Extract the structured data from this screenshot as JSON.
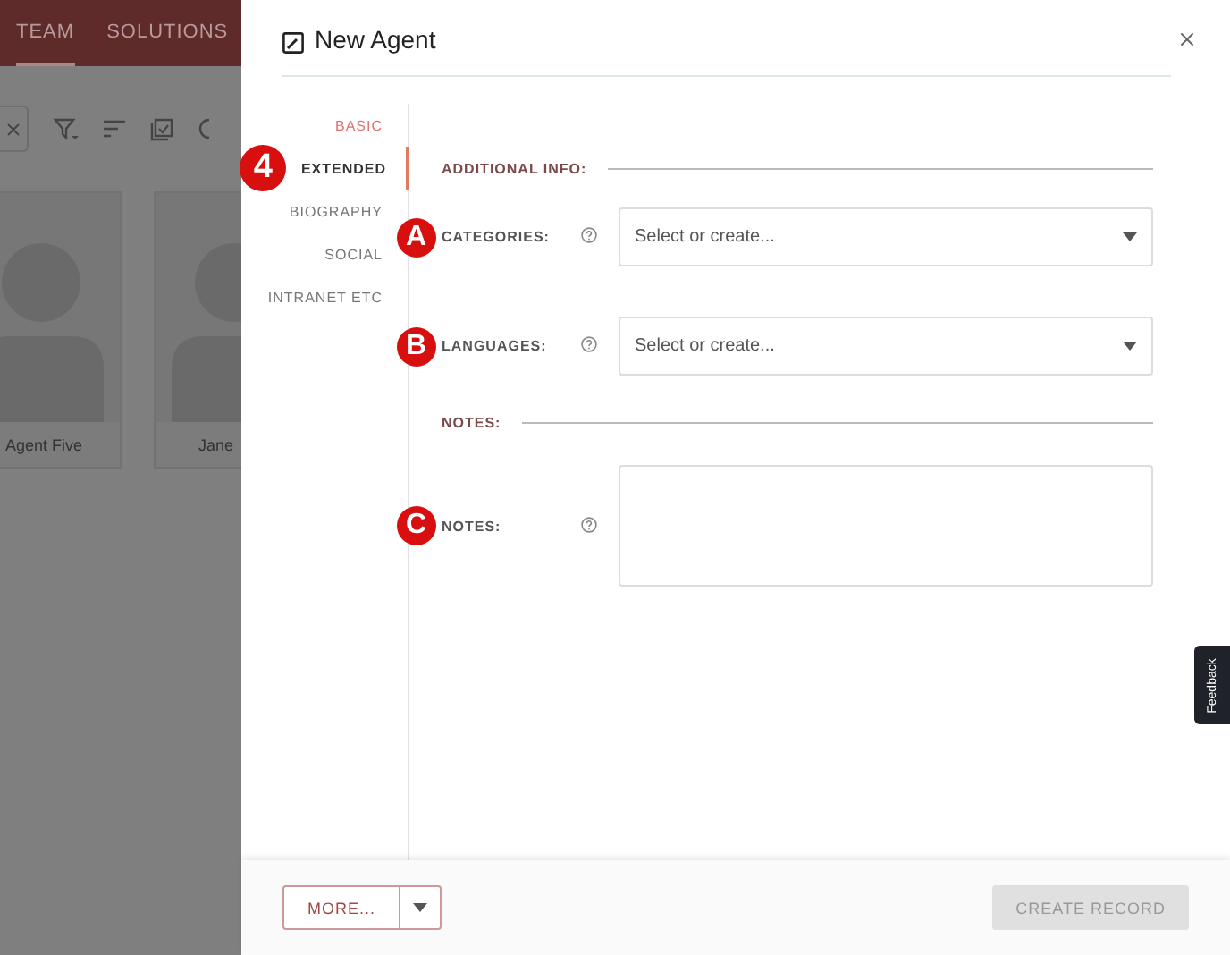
{
  "app": {
    "tabs": [
      {
        "label": "TEAM",
        "selected": true
      },
      {
        "label": "SOLUTIONS",
        "selected": false
      }
    ],
    "cards": [
      {
        "name": "Agent Five"
      },
      {
        "name": "Jane"
      }
    ]
  },
  "dialog": {
    "title": "New Agent",
    "nav": [
      {
        "label": "BASIC",
        "selected": false,
        "highlighted": true
      },
      {
        "label": "EXTENDED",
        "selected": true,
        "highlighted": false,
        "callout": "4"
      },
      {
        "label": "BIOGRAPHY",
        "selected": false,
        "highlighted": false
      },
      {
        "label": "SOCIAL",
        "selected": false,
        "highlighted": false
      },
      {
        "label": "INTRANET ETC",
        "selected": false,
        "highlighted": false
      }
    ],
    "sections": [
      {
        "heading": "ADDITIONAL INFO:",
        "fields": [
          {
            "label": "CATEGORIES:",
            "kind": "select",
            "placeholder": "Select or create...",
            "callout": "A"
          },
          {
            "label": "LANGUAGES:",
            "kind": "select",
            "placeholder": "Select or create...",
            "callout": "B"
          }
        ]
      },
      {
        "heading": "NOTES:",
        "fields": [
          {
            "label": "NOTES:",
            "kind": "textarea",
            "callout": "C"
          }
        ]
      }
    ],
    "more_button": "MORE...",
    "create_button": {
      "label": "CREATE RECORD",
      "disabled": true
    }
  },
  "feedback": "Feedback"
}
